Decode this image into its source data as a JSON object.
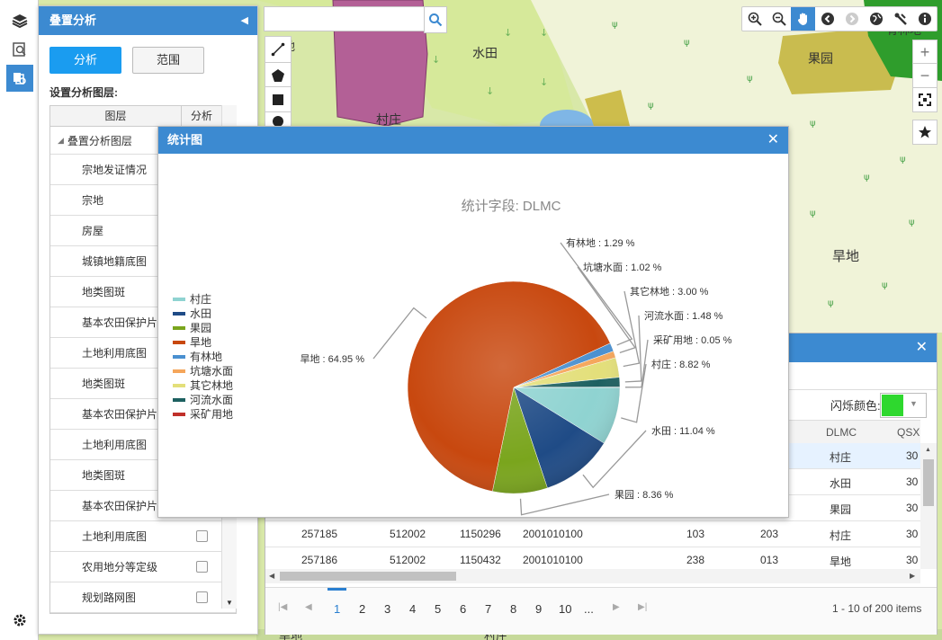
{
  "panel": {
    "title": "叠置分析",
    "analyze_btn": "分析",
    "range_btn": "范围",
    "section_label": "设置分析图层:",
    "col_layer": "图层",
    "col_analyze": "分析",
    "group": "叠置分析图层",
    "layers": [
      "宗地发证情况",
      "宗地",
      "房屋",
      "城镇地籍底图",
      "地类图斑",
      "基本农田保护片",
      "土地利用底图",
      "地类图斑",
      "基本农田保护片",
      "土地利用底图",
      "地类图斑",
      "基本农田保护片",
      "土地利用底图",
      "农用地分等定级",
      "规划路网图"
    ]
  },
  "map": {
    "labels": [
      "水田",
      "果园",
      "村庄",
      "旱地",
      "有林地",
      "地",
      "旱地",
      "村庄"
    ]
  },
  "stats": {
    "title": "统计图",
    "close": "✕"
  },
  "chart_data": {
    "type": "pie",
    "title": "统计字段: DLMC",
    "slices": [
      {
        "name": "村庄",
        "value": 8.82,
        "color": "#8fd3d1",
        "label": "村庄 : 8.82 %"
      },
      {
        "name": "水田",
        "value": 11.04,
        "color": "#1f4b86",
        "label": "水田 : 11.04 %"
      },
      {
        "name": "果园",
        "value": 8.36,
        "color": "#7aa51d",
        "label": "果园 : 8.36 %"
      },
      {
        "name": "旱地",
        "value": 64.95,
        "color": "#c8480f",
        "label": "旱地 : 64.95 %"
      },
      {
        "name": "有林地",
        "value": 1.29,
        "color": "#4a90d0",
        "label": "有林地 : 1.29 %"
      },
      {
        "name": "坑塘水面",
        "value": 1.02,
        "color": "#f5a65b",
        "label": "坑塘水面 : 1.02 %"
      },
      {
        "name": "其它林地",
        "value": 3.0,
        "color": "#e3df7a",
        "label": "其它林地 : 3.00 %"
      },
      {
        "name": "河流水面",
        "value": 1.48,
        "color": "#1d6060",
        "label": "河流水面 : 1.48 %"
      },
      {
        "name": "采矿用地",
        "value": 0.05,
        "color": "#c0302a",
        "label": "采矿用地 : 0.05 %"
      }
    ],
    "legend_position": "left"
  },
  "result": {
    "close": "✕",
    "flash_label": "闪烁颜色:",
    "flash_color": "#2ed82e",
    "col_dlmc": "DLMC",
    "col_qsx": "QSX",
    "rows_partial": [
      {
        "dlmc": "村庄",
        "qsx": "30"
      },
      {
        "dlmc": "水田",
        "qsx": "30"
      },
      {
        "dlmc": "果园",
        "qsx": "30"
      }
    ],
    "rows": [
      {
        "c1": "257185",
        "c2": "512002",
        "c3": "1150296",
        "c4": "2001010100",
        "c5": "103",
        "c6": "203",
        "dlmc": "村庄",
        "qsx": "30"
      },
      {
        "c1": "257186",
        "c2": "512002",
        "c3": "1150432",
        "c4": "2001010100",
        "c5": "238",
        "c6": "013",
        "dlmc": "旱地",
        "qsx": "30"
      }
    ],
    "pages": [
      "1",
      "2",
      "3",
      "4",
      "5",
      "6",
      "7",
      "8",
      "9",
      "10",
      "..."
    ],
    "page_info": "1 - 10 of 200 items"
  }
}
